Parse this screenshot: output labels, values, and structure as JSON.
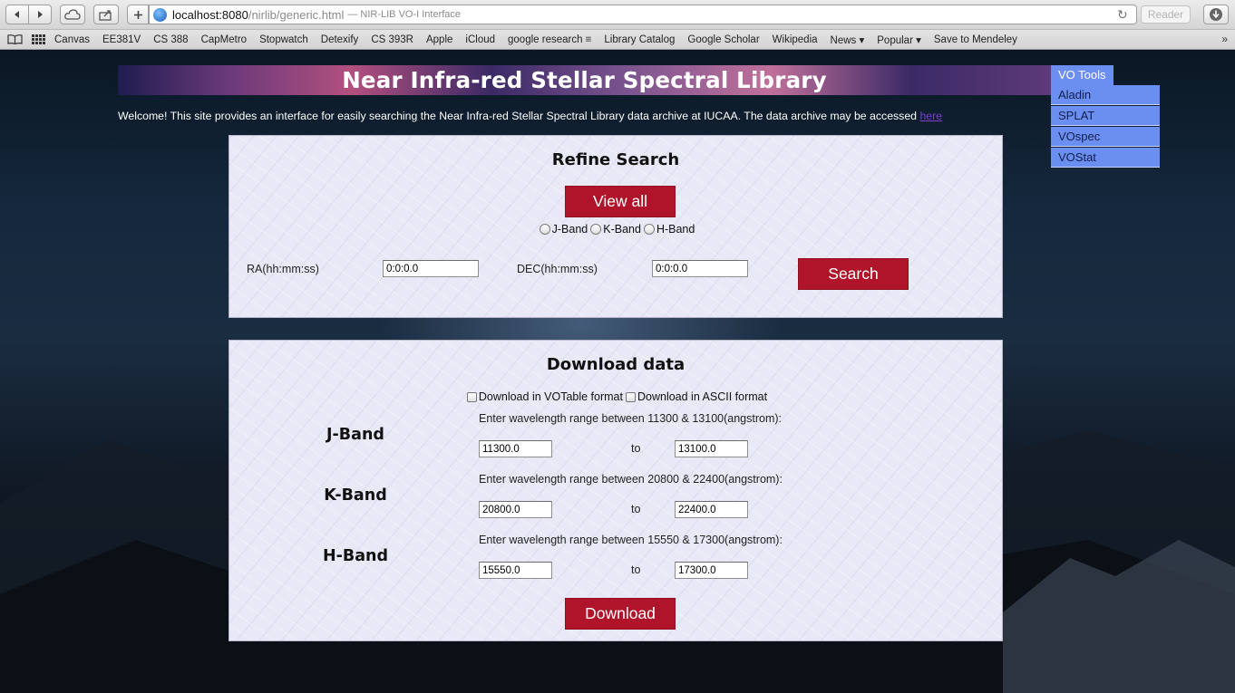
{
  "browser": {
    "url_host": "localhost:8080",
    "url_path": "/nirlib/generic.html",
    "page_title": "— NIR-LIB VO-I Interface",
    "reader_label": "Reader",
    "bookmarks": [
      "Canvas",
      "EE381V",
      "CS 388",
      "CapMetro",
      "Stopwatch",
      "Detexify",
      "CS 393R",
      "Apple",
      "iCloud",
      "google research ≡",
      "Library Catalog",
      "Google Scholar",
      "Wikipedia",
      "News ▾",
      "Popular ▾",
      "Save to Mendeley"
    ],
    "bookmarks_more": "»"
  },
  "header": {
    "title": "Near Infra-red Stellar Spectral Library",
    "welcome_text": "Welcome! This site provides an interface for easily searching the Near Infra-red Stellar Spectral Library data archive at IUCAA. The data archive may be accessed ",
    "welcome_link": "here"
  },
  "vo_tools": {
    "heading": "VO Tools",
    "items": [
      "Aladin",
      "SPLAT",
      "VOspec",
      "VOStat"
    ]
  },
  "refine": {
    "title": "Refine Search",
    "view_all_label": "View all",
    "bands": [
      "J-Band",
      "K-Band",
      "H-Band"
    ],
    "ra_label": "RA(hh:mm:ss)",
    "ra_value": "0:0:0.0",
    "dec_label": "DEC(hh:mm:ss)",
    "dec_value": "0:0:0.0",
    "search_label": "Search"
  },
  "download": {
    "title": "Download data",
    "votable_label": "Download in VOTable format",
    "ascii_label": "Download in ASCII format",
    "bands": [
      {
        "name": "J-Band",
        "range_text": "Enter wavelength range between 11300 & 13100(angstrom):",
        "from": "11300.0",
        "to_label": "to",
        "to": "13100.0"
      },
      {
        "name": "K-Band",
        "range_text": "Enter wavelength range between 20800 & 22400(angstrom):",
        "from": "20800.0",
        "to_label": "to",
        "to": "22400.0"
      },
      {
        "name": "H-Band",
        "range_text": "Enter wavelength range between 15550 & 17300(angstrom):",
        "from": "15550.0",
        "to_label": "to",
        "to": "17300.0"
      }
    ],
    "download_label": "Download"
  }
}
